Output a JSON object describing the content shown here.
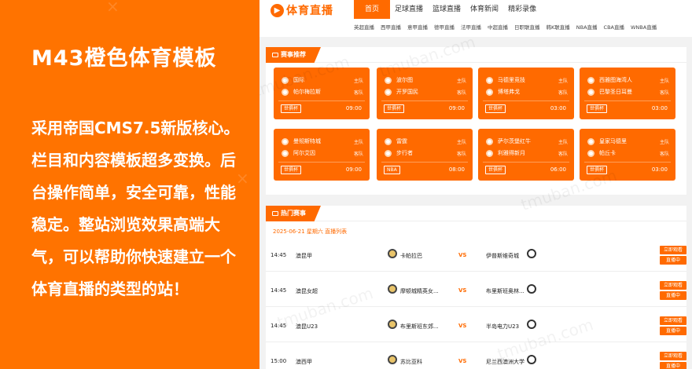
{
  "promo": {
    "title": "M43橙色体育模板",
    "body": "采用帝国CMS7.5新版核心。栏目和内容模板超多变换。后台操作简单，安全可靠，性能稳定。整站浏览效果高端大气，可以帮助你快速建立一个体育直播的类型的站！"
  },
  "watermark": "tmuban.com",
  "logo": {
    "text": "体育直播"
  },
  "nav": [
    "首页",
    "足球直播",
    "篮球直播",
    "体育新闻",
    "精彩录像"
  ],
  "subnav": [
    "英超直播",
    "西甲直播",
    "意甲直播",
    "德甲直播",
    "法甲直播",
    "中超直播",
    "日职联直播",
    "韩K联直播",
    "NBA直播",
    "CBA直播",
    "WNBA直播"
  ],
  "featured": {
    "title": "赛事推荐",
    "home_label": "主队",
    "away_label": "客队",
    "cards": [
      {
        "home": "国际",
        "away": "帕尔梅拉斯",
        "league": "世俱杯",
        "time": "09:00"
      },
      {
        "home": "波尔图",
        "away": "开罗国民",
        "league": "世俱杯",
        "time": "09:00"
      },
      {
        "home": "马德里竞技",
        "away": "博塔弗戈",
        "league": "世俱杯",
        "time": "03:00"
      },
      {
        "home": "西雅图海湾人",
        "away": "巴黎圣日耳曼",
        "league": "世俱杯",
        "time": "03:00"
      },
      {
        "home": "曼彻斯特城",
        "away": "阿尔艾因",
        "league": "世俱杯",
        "time": "09:00"
      },
      {
        "home": "雷霆",
        "away": "步行者",
        "league": "NBA",
        "time": "08:00"
      },
      {
        "home": "萨尔茨堡红牛",
        "away": "利雅得新月",
        "league": "世俱杯",
        "time": "06:00"
      },
      {
        "home": "皇家马德里",
        "away": "帕丘卡",
        "league": "世俱杯",
        "time": "03:00"
      }
    ]
  },
  "hot": {
    "title": "热门赛事",
    "date": "2025-06-21 星期六 直播列表",
    "vs": "VS",
    "btn_watch": "立即观看",
    "btn_live": "直播中",
    "matches": [
      {
        "time": "14:45",
        "league": "澳昆甲",
        "home": "卡帕拉巴",
        "away": "伊普斯维奇城"
      },
      {
        "time": "14:45",
        "league": "澳昆女超",
        "home": "摩顿城精英女...",
        "away": "布里斯班奥林..."
      },
      {
        "time": "14:45",
        "league": "澳昆U23",
        "home": "布里斯班东郊...",
        "away": "半岛电力U23"
      },
      {
        "time": "15:00",
        "league": "澳西甲",
        "home": "苏比亚科",
        "away": "尼兰西澳洲大学"
      }
    ]
  },
  "colors": {
    "accent": "#ff6a00",
    "promo_bg": "#ff7300"
  }
}
